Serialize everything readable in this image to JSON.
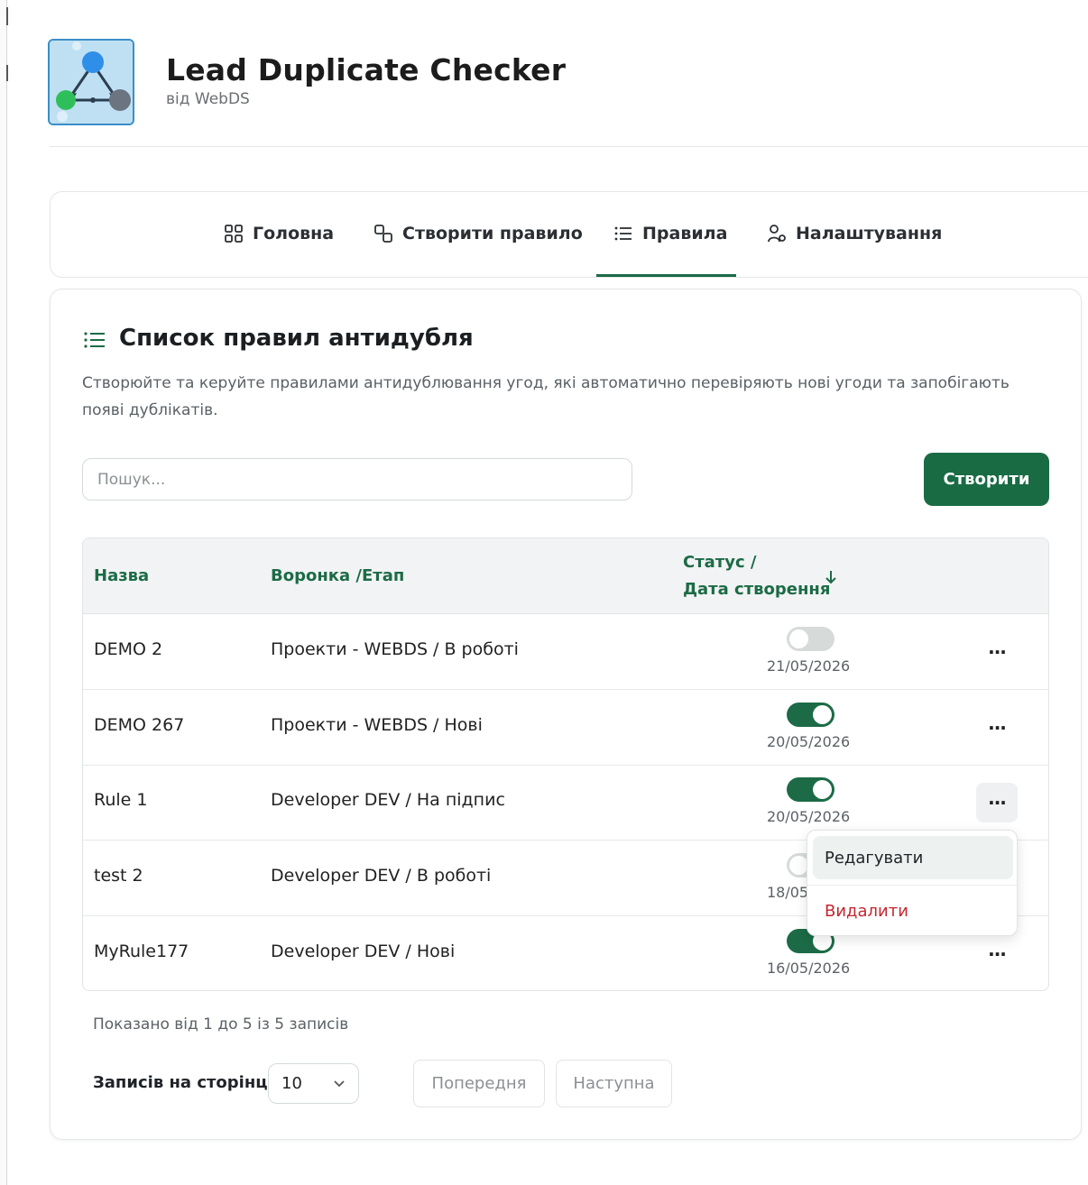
{
  "app": {
    "title": "Lead Duplicate Checker",
    "author": "від WebDS"
  },
  "nav": {
    "tabs": [
      {
        "label": "Головна",
        "icon": "grid-icon",
        "active": false
      },
      {
        "label": "Створити правило",
        "icon": "link-icon",
        "active": false
      },
      {
        "label": "Правила",
        "icon": "list-icon",
        "active": true
      },
      {
        "label": "Налаштування",
        "icon": "user-settings-icon",
        "active": false
      }
    ]
  },
  "page": {
    "title": "Список правил антидубля",
    "description": "Створюйте та керуйте правилами антидублювання угод, які автоматично перевіряють нові угоди та запобігають появі дублікатів."
  },
  "search": {
    "placeholder": "Пошук...",
    "value": ""
  },
  "create_label": "Створити",
  "table": {
    "headers": {
      "name": "Назва",
      "funnel": "Воронка /Етап",
      "status_line1": "Статус /",
      "status_line2": "Дата створення"
    },
    "rows": [
      {
        "name": "DEMO 2",
        "funnel": "Проекти - WEBDS / В роботі",
        "enabled": false,
        "date": "21/05/2026"
      },
      {
        "name": "DEMO 267",
        "funnel": "Проекти - WEBDS / Нові",
        "enabled": true,
        "date": "20/05/2026"
      },
      {
        "name": "Rule 1",
        "funnel": "Developer DEV / На підпис",
        "enabled": true,
        "date": "20/05/2026"
      },
      {
        "name": "test 2",
        "funnel": "Developer DEV / В роботі",
        "enabled": false,
        "date": "18/05"
      },
      {
        "name": "MyRule177",
        "funnel": "Developer DEV / Нові",
        "enabled": true,
        "date": "16/05/2026"
      }
    ],
    "menu_symbol": "···"
  },
  "row_menu": {
    "edit_label": "Редагувати",
    "delete_label": "Видалити"
  },
  "footer": {
    "shown_text": "Показано від 1 до 5 із 5 записів",
    "per_page_label": "Записів на сторінці",
    "per_page_value": "10",
    "prev_label": "Попередня",
    "next_label": "Наступна"
  },
  "colors": {
    "accent": "#1c6b46",
    "delete": "#c4262e"
  }
}
